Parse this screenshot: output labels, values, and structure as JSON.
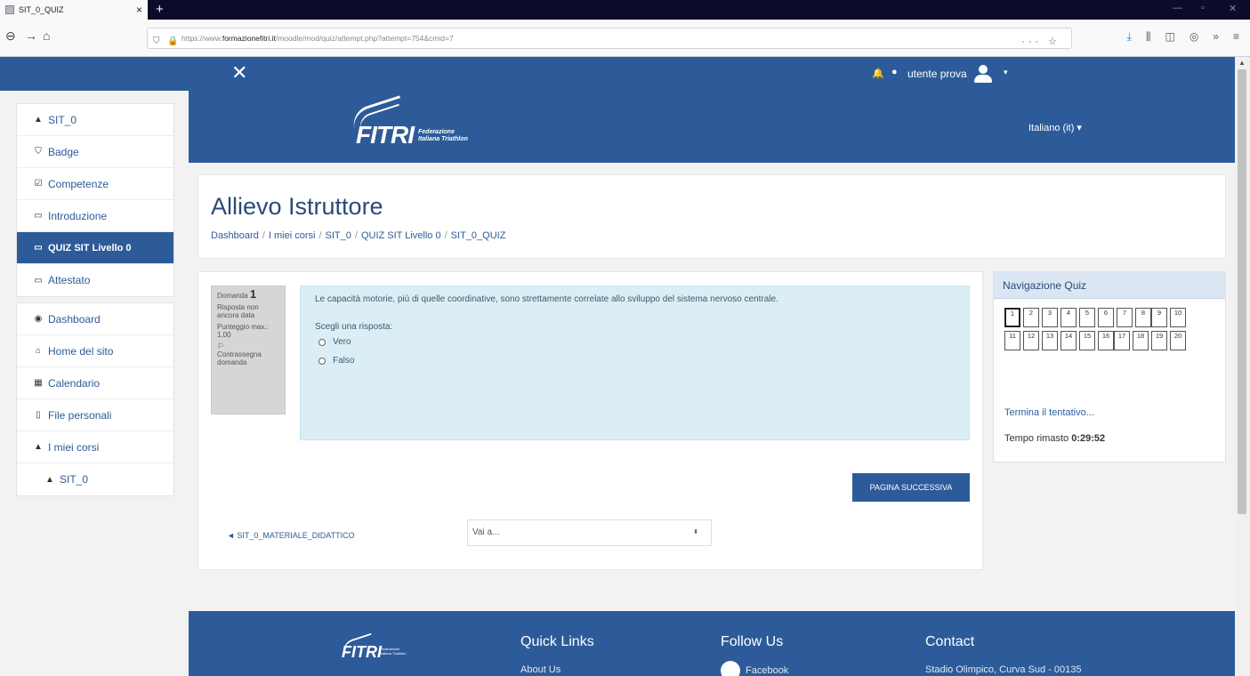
{
  "browser": {
    "tab_title": "SIT_0_QUIZ",
    "url_prefix": "https://www.",
    "url_domain": "formazionefitri.it",
    "url_path": "/moodle/mod/quiz/attempt.php?attempt=754&cmid=7",
    "url_right_icons": "··· ☆"
  },
  "topnav": {
    "user_name": "utente prova"
  },
  "drawer": {
    "group1": [
      {
        "label": "SIT_0",
        "icon": "graduation-cap-icon",
        "glyph": "🎓"
      },
      {
        "label": "Badge",
        "icon": "shield-icon",
        "glyph": "⛉"
      },
      {
        "label": "Competenze",
        "icon": "checkbox-icon",
        "glyph": "☑"
      },
      {
        "label": "Introduzione",
        "icon": "folder-icon",
        "glyph": "▭"
      },
      {
        "label": "QUIZ SIT Livello 0",
        "icon": "folder-icon",
        "glyph": "▭"
      },
      {
        "label": "Attestato",
        "icon": "folder-icon",
        "glyph": "▭"
      }
    ],
    "group2": [
      {
        "label": "Dashboard",
        "icon": "dashboard-icon",
        "glyph": "◉"
      },
      {
        "label": "Home del sito",
        "icon": "home-icon",
        "glyph": "⌂"
      },
      {
        "label": "Calendario",
        "icon": "calendar-icon",
        "glyph": "▦"
      },
      {
        "label": "File personali",
        "icon": "file-icon",
        "glyph": "▯"
      },
      {
        "label": "I miei corsi",
        "icon": "graduation-cap-icon",
        "glyph": "🎓"
      },
      {
        "label": "SIT_0",
        "icon": "graduation-cap-icon",
        "glyph": "🎓"
      }
    ]
  },
  "banner": {
    "logo_word": "FITRI",
    "logo_sub1": "Federazione",
    "logo_sub2": "Italiana Triathlon",
    "language": "Italiano (it) ▾"
  },
  "page": {
    "title": "Allievo Istruttore",
    "breadcrumb": [
      "Dashboard",
      "I miei corsi",
      "SIT_0",
      "QUIZ SIT Livello 0",
      "SIT_0_QUIZ"
    ]
  },
  "question": {
    "label": "Domanda",
    "number": "1",
    "status": "Risposta non ancora data",
    "score": "Punteggio max.: 1,00",
    "flag": "Contrassegna domanda",
    "text": "Le capacità motorie, più di quelle coordinative, sono strettamente correlate allo sviluppo del sistema nervoso centrale.",
    "prompt": "Scegli una risposta:",
    "options": [
      "Vero",
      "Falso"
    ]
  },
  "controls": {
    "next": "PAGINA SUCCESSIVA",
    "prev": "◄ SIT_0_MATERIALE_DIDATTICO",
    "jump_placeholder": "Vai a...",
    "jump_arrows": "⬍"
  },
  "quiznav": {
    "title": "Navigazione Quiz",
    "current": 1,
    "questions": [
      "1",
      "2",
      "3",
      "4",
      "5",
      "6",
      "7",
      "8",
      "9",
      "10",
      "11",
      "12",
      "13",
      "14",
      "15",
      "16",
      "17",
      "18",
      "19",
      "20"
    ],
    "finish": "Termina il tentativo...",
    "time_label": "Tempo rimasto",
    "time_value": "0:29:52"
  },
  "footer": {
    "logo_word": "FITRI",
    "quick_links": "Quick Links",
    "about": "About Us",
    "follow": "Follow Us",
    "facebook": "Facebook",
    "contact": "Contact",
    "address": "Stadio Olimpico, Curva Sud - 00135"
  },
  "colors": {
    "primary": "#2d5b99",
    "question_bg": "#dbeef6",
    "nav_header": "#dbe6f3"
  }
}
